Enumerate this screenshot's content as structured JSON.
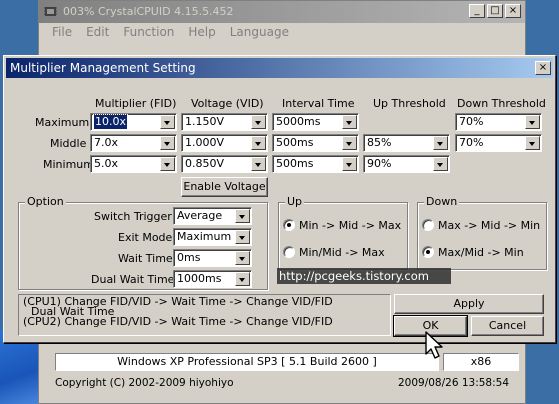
{
  "main_window": {
    "title": "003% CrystalCPUID 4.15.5.452",
    "controls": {
      "minimize": "_",
      "maximize": "□",
      "close": "×"
    },
    "menu": [
      "File",
      "Edit",
      "Function",
      "Help",
      "Language"
    ],
    "os_info": "Windows XP Professional SP3 [ 5.1 Build 2600 ]",
    "arch": "x86",
    "copyright": "Copyright (C) 2002-2009 hiyohiyo",
    "datetime": "2009/08/26 13:58:54"
  },
  "dialog": {
    "title": "Multiplier Management Setting",
    "close": "×",
    "columns": {
      "multiplier": "Multiplier (FID)",
      "voltage": "Voltage (VID)",
      "interval": "Interval Time",
      "up_threshold": "Up Threshold",
      "down_threshold": "Down Threshold"
    },
    "rows": {
      "maximum": {
        "label": "Maximum",
        "multiplier": "10.0x",
        "voltage": "1.150V",
        "interval": "5000ms",
        "down_threshold": "70%"
      },
      "middle": {
        "label": "Middle",
        "multiplier": "7.0x",
        "voltage": "1.000V",
        "interval": "500ms",
        "up_threshold": "85%",
        "down_threshold": "70%"
      },
      "minimum": {
        "label": "Minimum",
        "multiplier": "5.0x",
        "voltage": "0.850V",
        "interval": "500ms",
        "up_threshold": "90%"
      }
    },
    "enable_voltage": "Enable Voltage",
    "option": {
      "title": "Option",
      "switch_trigger": {
        "label": "Switch Trigger",
        "value": "Average"
      },
      "exit_mode": {
        "label": "Exit Mode",
        "value": "Maximum"
      },
      "wait_time": {
        "label": "Wait Time",
        "value": "0ms"
      },
      "dual_wait_time": {
        "label": "Dual Wait Time",
        "value": "1000ms"
      }
    },
    "up": {
      "title": "Up",
      "opt1": "Min -> Mid -> Max",
      "opt2": "Min/Mid -> Max",
      "selected": 1
    },
    "down": {
      "title": "Down",
      "opt1": "Max -> Mid -> Min",
      "opt2": "Max/Mid -> Min",
      "selected": 2
    },
    "log": [
      "(CPU1) Change FID/VID -> Wait Time -> Change VID/FID",
      "  Dual Wait Time",
      "(CPU2) Change FID/VID -> Wait Time -> Change VID/FID"
    ],
    "buttons": {
      "apply": "Apply",
      "ok": "OK",
      "cancel": "Cancel"
    },
    "watermark": "http://pcgeeks.tistory.com"
  },
  "icons": {
    "app": "chip-icon",
    "cursor": "mouse-pointer-icon"
  }
}
